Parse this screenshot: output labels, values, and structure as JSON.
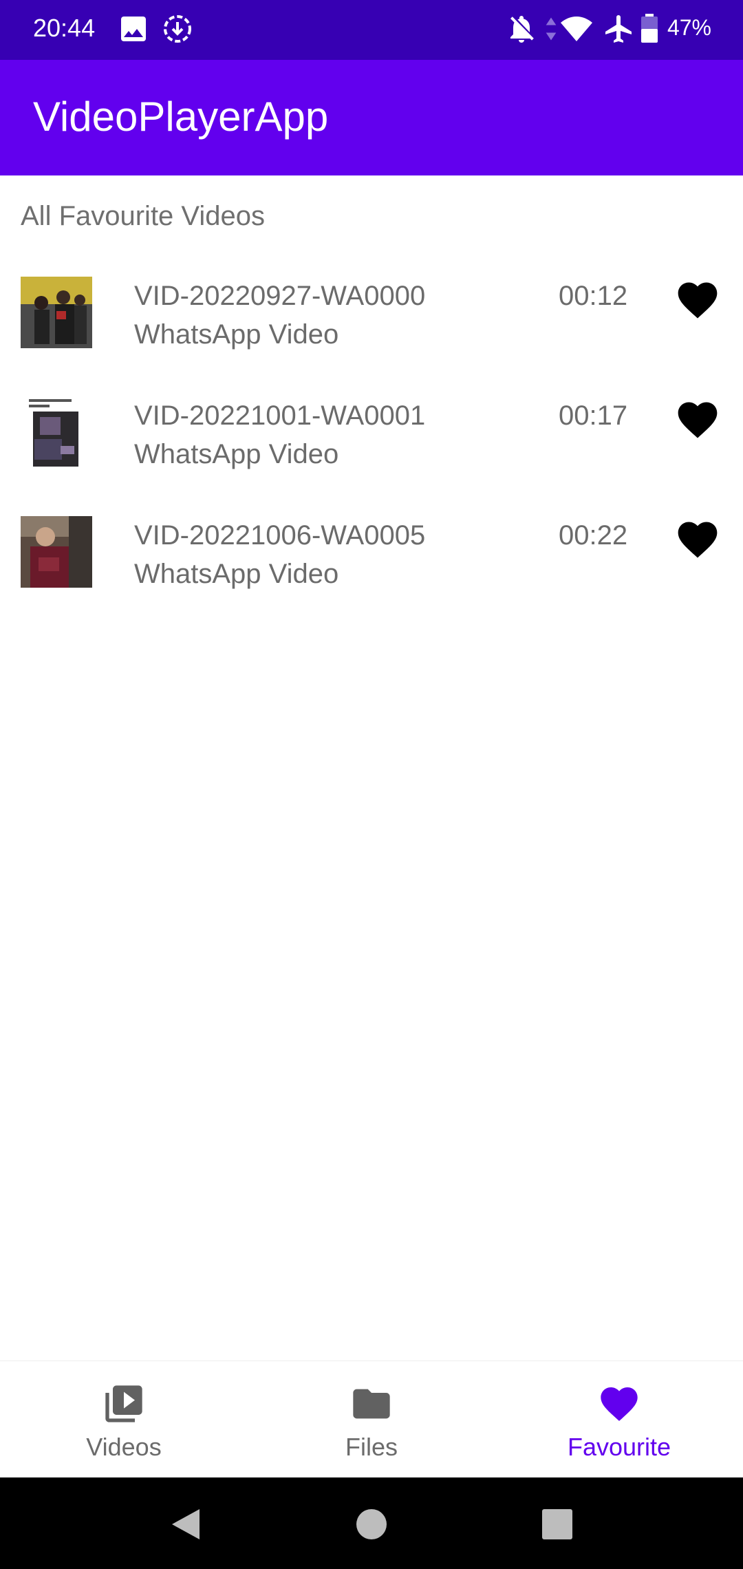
{
  "status_bar": {
    "time": "20:44",
    "battery_percent": "47%",
    "icons": [
      "image-icon",
      "download-icon",
      "notifications-off-icon",
      "wifi-icon",
      "airplane-icon",
      "battery-icon"
    ]
  },
  "app_bar": {
    "title": "VideoPlayerApp"
  },
  "section_title": "All Favourite Videos",
  "videos": [
    {
      "title": "VID-20220927-WA0000",
      "subtitle": "WhatsApp Video",
      "duration": "00:12",
      "favourite": true
    },
    {
      "title": "VID-20221001-WA0001",
      "subtitle": "WhatsApp Video",
      "duration": "00:17",
      "favourite": true
    },
    {
      "title": "VID-20221006-WA0005",
      "subtitle": "WhatsApp Video",
      "duration": "00:22",
      "favourite": true
    }
  ],
  "bottom_nav": {
    "items": [
      {
        "label": "Videos",
        "icon": "video-library-icon",
        "active": false
      },
      {
        "label": "Files",
        "icon": "folder-icon",
        "active": false
      },
      {
        "label": "Favourite",
        "icon": "heart-icon",
        "active": true
      }
    ]
  },
  "colors": {
    "primary": "#6200ee",
    "primary_dark": "#3700b3",
    "text_secondary": "#6b6b6b"
  }
}
